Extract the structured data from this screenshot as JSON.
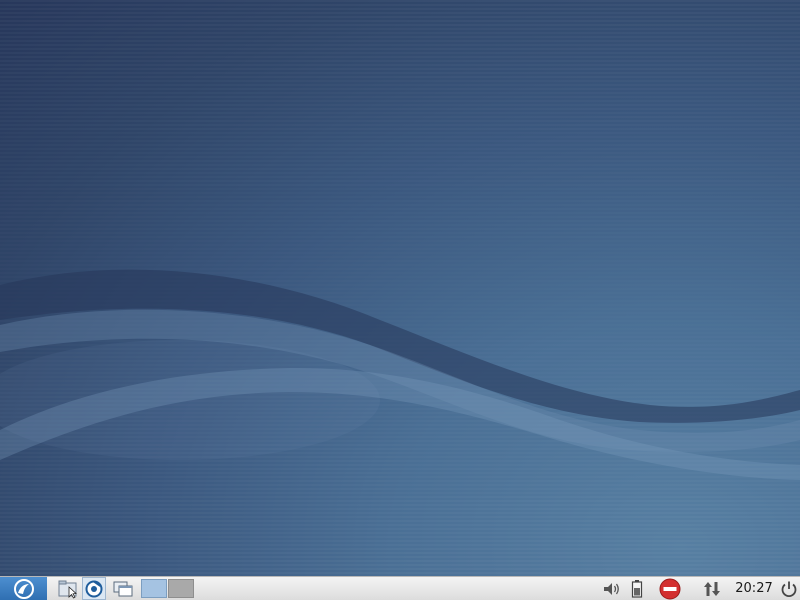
{
  "desktop": {
    "background_colors": {
      "top": "#27375b",
      "mid": "#3b587f",
      "bottom_right": "#577fa2"
    }
  },
  "taskbar": {
    "background": "#e6e6e6",
    "menu_button": {
      "icon": "lxde-menu-icon",
      "color": "#3a7fc4"
    },
    "launchers": [
      {
        "name": "file-manager",
        "icon": "file-manager-icon"
      },
      {
        "name": "web-browser",
        "icon": "browser-icon"
      }
    ],
    "show_desktop": {
      "icon": "show-desktop-icon"
    },
    "workspaces": [
      {
        "name": "workspace-1",
        "active": true,
        "color": "#a5c3e2"
      },
      {
        "name": "workspace-2",
        "active": false,
        "color": "#a9a9a9"
      }
    ],
    "tray": {
      "volume": {
        "icon": "volume-icon"
      },
      "battery": {
        "icon": "battery-icon"
      },
      "status": {
        "icon": "stop-icon",
        "color": "#d32f2f"
      },
      "network": {
        "icon": "network-transfer-icon"
      }
    },
    "clock": "20:27",
    "power": {
      "icon": "power-icon"
    }
  }
}
